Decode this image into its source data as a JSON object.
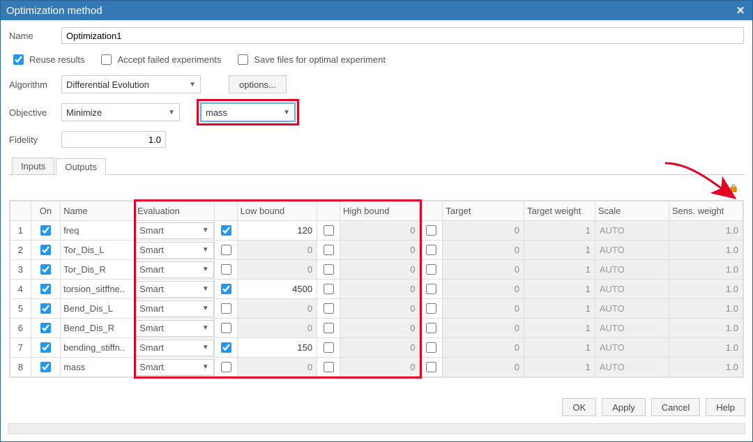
{
  "window": {
    "title": "Optimization method"
  },
  "name_label": "Name",
  "name_value": "Optimization1",
  "checks": {
    "reuse": {
      "label": "Reuse results",
      "checked": true
    },
    "accept_failed": {
      "label": "Accept failed experiments",
      "checked": false
    },
    "save_optimal": {
      "label": "Save files for optimal experiment",
      "checked": false
    }
  },
  "algorithm": {
    "label": "Algorithm",
    "value": "Differential Evolution",
    "options_btn": "options..."
  },
  "objective": {
    "label": "Objective",
    "type": "Minimize",
    "target": "mass"
  },
  "fidelity": {
    "label": "Fidelity",
    "value": "1.0"
  },
  "tabs": {
    "inputs": "Inputs",
    "outputs": "Outputs"
  },
  "table": {
    "headers": {
      "on": "On",
      "name": "Name",
      "evaluation": "Evaluation",
      "low": "Low bound",
      "high": "High bound",
      "target": "Target",
      "tw": "Target weight",
      "scale": "Scale",
      "sw": "Sens. weight"
    },
    "rows": [
      {
        "idx": "1",
        "on": true,
        "name": "freq",
        "eval": "Smart",
        "low_en": true,
        "low": "120",
        "high_en": false,
        "high": "0",
        "tgt_en": false,
        "target": "0",
        "tw": "1",
        "scale": "AUTO",
        "sw": "1.0"
      },
      {
        "idx": "2",
        "on": true,
        "name": "Tor_Dis_L",
        "eval": "Smart",
        "low_en": false,
        "low": "0",
        "high_en": false,
        "high": "0",
        "tgt_en": false,
        "target": "0",
        "tw": "1",
        "scale": "AUTO",
        "sw": "1.0"
      },
      {
        "idx": "3",
        "on": true,
        "name": "Tor_Dis_R",
        "eval": "Smart",
        "low_en": false,
        "low": "0",
        "high_en": false,
        "high": "0",
        "tgt_en": false,
        "target": "0",
        "tw": "1",
        "scale": "AUTO",
        "sw": "1.0"
      },
      {
        "idx": "4",
        "on": true,
        "name": "torsion_sitffne..",
        "eval": "Smart",
        "low_en": true,
        "low": "4500",
        "high_en": false,
        "high": "0",
        "tgt_en": false,
        "target": "0",
        "tw": "1",
        "scale": "AUTO",
        "sw": "1.0"
      },
      {
        "idx": "5",
        "on": true,
        "name": "Bend_Dis_L",
        "eval": "Smart",
        "low_en": false,
        "low": "0",
        "high_en": false,
        "high": "0",
        "tgt_en": false,
        "target": "0",
        "tw": "1",
        "scale": "AUTO",
        "sw": "1.0"
      },
      {
        "idx": "6",
        "on": true,
        "name": "Bend_Dis_R",
        "eval": "Smart",
        "low_en": false,
        "low": "0",
        "high_en": false,
        "high": "0",
        "tgt_en": false,
        "target": "0",
        "tw": "1",
        "scale": "AUTO",
        "sw": "1.0"
      },
      {
        "idx": "7",
        "on": true,
        "name": "bending_stiffn..",
        "eval": "Smart",
        "low_en": true,
        "low": "150",
        "high_en": false,
        "high": "0",
        "tgt_en": false,
        "target": "0",
        "tw": "1",
        "scale": "AUTO",
        "sw": "1.0"
      },
      {
        "idx": "8",
        "on": true,
        "name": "mass",
        "eval": "Smart",
        "low_en": false,
        "low": "0",
        "high_en": false,
        "high": "0",
        "tgt_en": false,
        "target": "0",
        "tw": "1",
        "scale": "AUTO",
        "sw": "1.0"
      }
    ]
  },
  "buttons": {
    "ok": "OK",
    "apply": "Apply",
    "cancel": "Cancel",
    "help": "Help"
  }
}
